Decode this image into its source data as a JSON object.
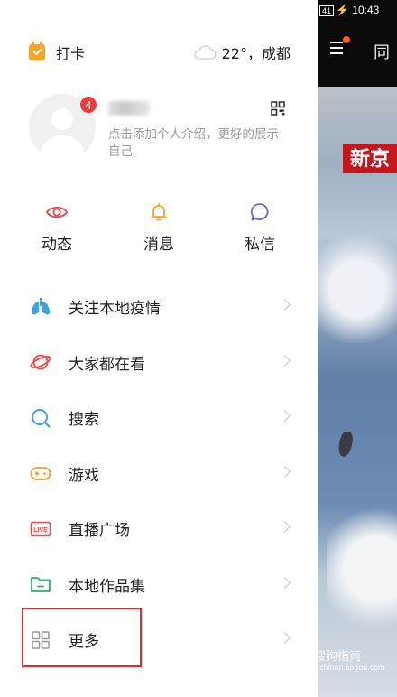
{
  "status_bar": {
    "battery": "41",
    "time": "10:43"
  },
  "background": {
    "tab_partial": "同",
    "news_banner": "新京",
    "watermark": "搜狗指南",
    "watermark_sub": "zhinan.sogou.com"
  },
  "header": {
    "checkin_label": "打卡",
    "weather": "22°，成都"
  },
  "profile": {
    "notification_count": "4",
    "bio": "点击添加个人介绍，更好的展示自己"
  },
  "quick_actions": [
    {
      "label": "动态",
      "icon": "eye-icon",
      "color": "#e8474b"
    },
    {
      "label": "消息",
      "icon": "bell-icon",
      "color": "#f5a623"
    },
    {
      "label": "私信",
      "icon": "chat-bubble-icon",
      "color": "#6b63e6"
    }
  ],
  "menu": [
    {
      "label": "关注本地疫情",
      "icon": "lungs-icon",
      "color": "#3aa3e3"
    },
    {
      "label": "大家都在看",
      "icon": "planet-icon",
      "color": "#ef4b4b"
    },
    {
      "label": "搜索",
      "icon": "search-icon",
      "color": "#3d9be9"
    },
    {
      "label": "游戏",
      "icon": "gamepad-icon",
      "color": "#f39a2b"
    },
    {
      "label": "直播广场",
      "icon": "live-icon",
      "color": "#ef4b4b",
      "icon_text": "LIVE"
    },
    {
      "label": "本地作品集",
      "icon": "folder-icon",
      "color": "#27b36b"
    },
    {
      "label": "更多",
      "icon": "grid-icon",
      "color": "#9a9a9a"
    }
  ],
  "colors": {
    "highlight_border": "#e02b2b",
    "badge": "#f23a3a"
  }
}
